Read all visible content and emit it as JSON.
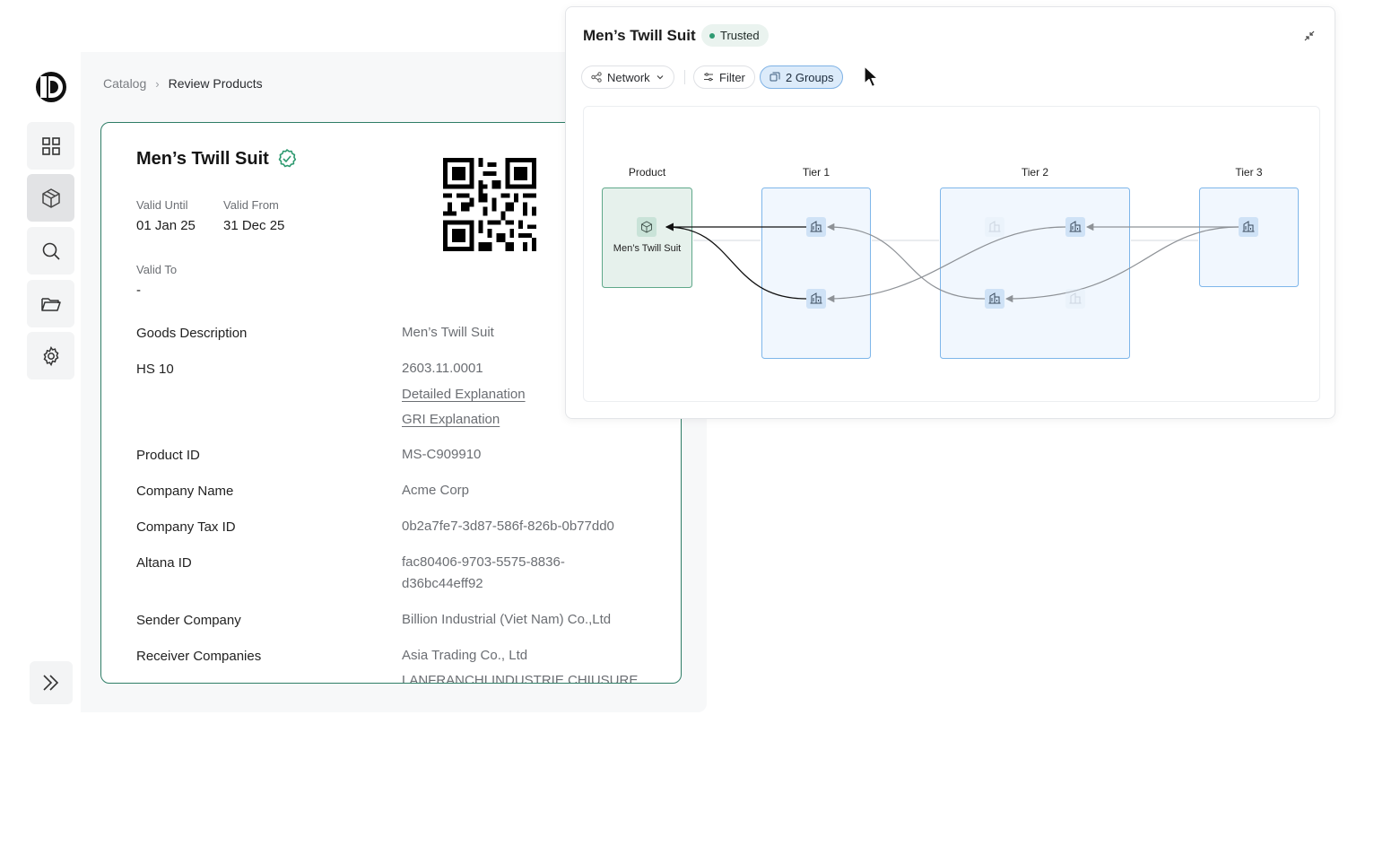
{
  "breadcrumb": {
    "items": [
      "Catalog",
      "Review Products"
    ]
  },
  "product": {
    "title": "Men’s Twill Suit",
    "valid_until_label": "Valid Until",
    "valid_until_value": "01 Jan 25",
    "valid_from_label": "Valid From",
    "valid_from_value": "31 Dec 25",
    "valid_to_label": "Valid To",
    "valid_to_value": "-",
    "rows": {
      "goods_description": {
        "label": "Goods Description",
        "value": "Men’s Twill Suit"
      },
      "hs10": {
        "label": "HS 10",
        "value": "2603.11.0001",
        "link1": "Detailed Explanation",
        "link2": "GRI Explanation"
      },
      "product_id": {
        "label": "Product ID",
        "value": "MS-C909910"
      },
      "company_name": {
        "label": "Company Name",
        "value": "Acme Corp"
      },
      "company_tax_id": {
        "label": "Company Tax ID",
        "value": "0b2a7fe7-3d87-586f-826b-0b77dd0"
      },
      "altana_id": {
        "label": "Altana ID",
        "value_line1": "fac80406-9703-5575-8836-",
        "value_line2": "d36bc44eff92"
      },
      "sender_company": {
        "label": "Sender Company",
        "value": "Billion Industrial (Viet Nam) Co.,Ltd"
      },
      "receiver_companies": {
        "label": "Receiver Companies",
        "value1": "Asia Trading Co., Ltd",
        "value2": "LANFRANCHI INDUSTRIE CHIUSURE"
      }
    }
  },
  "network_panel": {
    "title": "Men’s Twill Suit",
    "badge": "Trusted",
    "toolbar": {
      "view_label": "Network",
      "filter_label": "Filter",
      "groups_label": "2 Groups"
    },
    "tiers": [
      "Product",
      "Tier 1",
      "Tier 2",
      "Tier 3"
    ],
    "product_node_label": "Men’s Twill Suit"
  },
  "colors": {
    "accent_green": "#2e7d66",
    "trusted_dot": "#2f9a72",
    "tier_fill": "#f1f7fe",
    "tier_border": "#7eb6ea",
    "active_button": "#dcebfa"
  },
  "icons": [
    "grid-icon",
    "box-icon",
    "search-icon",
    "folder-icon",
    "gear-icon",
    "double-chevron-right-icon",
    "verified-badge-icon",
    "qr-code",
    "network-icon",
    "chevron-down-icon",
    "filter-icon",
    "groups-icon",
    "collapse-icon",
    "building-icon",
    "box-node-icon"
  ]
}
